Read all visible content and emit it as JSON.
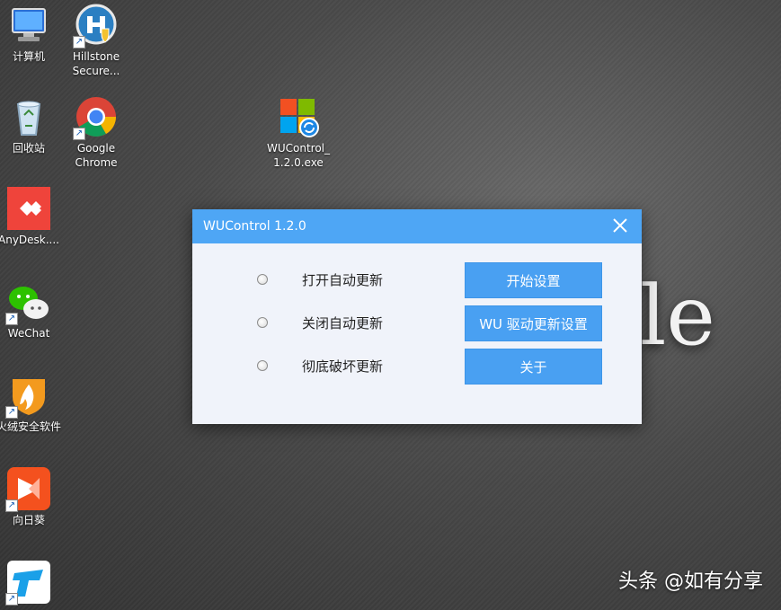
{
  "desktop_icons": [
    {
      "label": "计算机"
    },
    {
      "label": "Hillstone Secure..."
    },
    {
      "label": "回收站"
    },
    {
      "label": "Google Chrome"
    },
    {
      "label": "WUControl_ 1.2.0.exe"
    },
    {
      "label": "AnyDesk...."
    },
    {
      "label": "WeChat"
    },
    {
      "label": "火绒安全软件"
    },
    {
      "label": "向日葵"
    }
  ],
  "background_logo_text": "le",
  "watermark": "头条 @如有分享",
  "dialog": {
    "title": "WUControl 1.2.0",
    "options": [
      {
        "label": "打开自动更新",
        "selected": false
      },
      {
        "label": "关闭自动更新",
        "selected": false
      },
      {
        "label": "彻底破坏更新",
        "selected": false
      }
    ],
    "buttons": {
      "start_settings": "开始设置",
      "wu_driver_settings": "WU 驱动更新设置",
      "about": "关于"
    }
  }
}
